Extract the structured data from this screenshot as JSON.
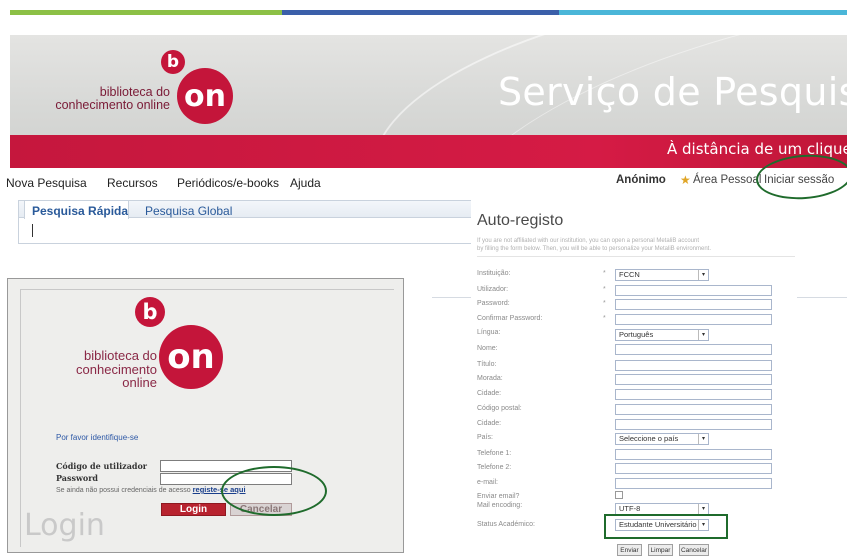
{
  "colors": {
    "strip_green": "#8cc046",
    "strip_blue": "#3b5fa9",
    "strip_cyan": "#4ab6d8",
    "brand_red": "#c4153a",
    "highlight_green": "#1f6b2c"
  },
  "banner": {
    "logo_line1": "biblioteca do",
    "logo_line2": "conhecimento online",
    "logo_small_letter": "b",
    "logo_big_word": "on",
    "service_title": "Serviço de Pesquisa",
    "tagline": "À distância de um clique!"
  },
  "nav": {
    "items": [
      "Nova Pesquisa",
      "Recursos",
      "Periódicos/e-books",
      "Ajuda"
    ],
    "user": "Anónimo",
    "personal_area": "Área Pessoal",
    "sign_in": "Iniciar sessão"
  },
  "search": {
    "tabs": [
      "Pesquisa Rápida",
      "Pesquisa Global"
    ],
    "query": ""
  },
  "login": {
    "logo_line1": "biblioteca do",
    "logo_line2": "conhecimento",
    "logo_line3": "online",
    "logo_small_letter": "b",
    "logo_big_word": "on",
    "prompt": "Por favor identifique-se",
    "user_label": "Código de utilizador",
    "password_label": "Password",
    "register_text": "Se ainda não possui credenciais de acesso",
    "register_link": "registe-se aqui",
    "login_button": "Login",
    "cancel_button": "Cancelar",
    "watermark": "Login"
  },
  "registration": {
    "title": "Auto-registo",
    "intro_line1": "If you are not affiliated with our institution, you can open a personal MetaliB account",
    "intro_line2": "by filling the form below. Then, you will be able to personalize your MetaliB environment.",
    "fields": {
      "institution": {
        "label": "Instituição:",
        "value": "FCCN"
      },
      "user": {
        "label": "Utilizador:"
      },
      "password": {
        "label": "Password:"
      },
      "confirm_password": {
        "label": "Confirmar Password:"
      },
      "language": {
        "label": "Língua:",
        "value": "Português"
      },
      "name": {
        "label": "Nome:"
      },
      "title": {
        "label": "Título:"
      },
      "address": {
        "label": "Morada:"
      },
      "city": {
        "label": "Cidade:"
      },
      "postal_code": {
        "label": "Código postal:"
      },
      "city2": {
        "label": "Cidade:"
      },
      "country": {
        "label": "País:",
        "value": "Seleccione o país"
      },
      "phone1": {
        "label": "Telefone 1:"
      },
      "phone2": {
        "label": "Telefone 2:"
      },
      "email": {
        "label": "e-mail:"
      },
      "send_email": {
        "label": "Enviar email?"
      },
      "mail_encoding": {
        "label": "Mail encoding:",
        "value": "UTF-8"
      },
      "academic_status": {
        "label": "Status Académico:",
        "value": "Estudante Universitário"
      }
    },
    "buttons": {
      "send": "Enviar",
      "clear": "Limpar",
      "cancel": "Cancelar"
    }
  }
}
